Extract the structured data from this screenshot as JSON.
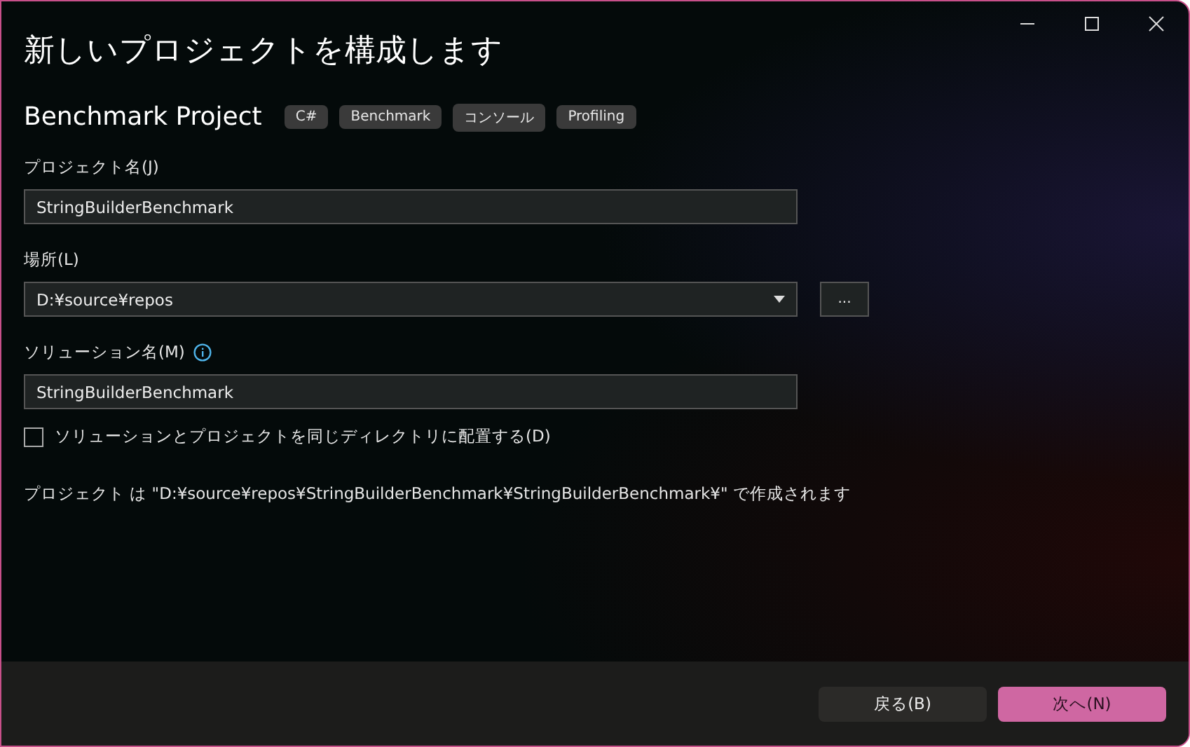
{
  "window": {
    "title": "新しいプロジェクトを構成します"
  },
  "project": {
    "name": "Benchmark Project",
    "tags": [
      "C#",
      "Benchmark",
      "コンソール",
      "Profiling"
    ]
  },
  "fields": [
    {
      "kind": "text",
      "label": "プロジェクト名(J)",
      "value": "StringBuilderBenchmark"
    },
    {
      "kind": "dropdown",
      "label": "場所(L)",
      "value": "D:¥source¥repos",
      "browse": "..."
    },
    {
      "kind": "text",
      "label": "ソリューション名(M)",
      "info": true,
      "value": "StringBuilderBenchmark"
    }
  ],
  "same_directory": {
    "label": "ソリューションとプロジェクトを同じディレクトリに配置する(D)",
    "checked": false
  },
  "summary": "プロジェクト は \"D:¥source¥repos¥StringBuilderBenchmark¥StringBuilderBenchmark¥\" で作成されます",
  "buttons": [
    {
      "label": "戻る(B)",
      "kind": "secondary"
    },
    {
      "label": "次へ(N)",
      "kind": "primary"
    }
  ]
}
